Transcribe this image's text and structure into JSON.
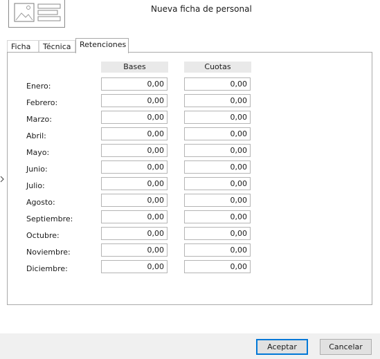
{
  "dialog": {
    "title": "Nueva ficha de personal"
  },
  "tabs": [
    {
      "label": "Ficha"
    },
    {
      "label": "Técnica"
    },
    {
      "label": "Retenciones",
      "active": true
    }
  ],
  "retenciones": {
    "columns": {
      "bases": "Bases",
      "cuotas": "Cuotas"
    },
    "rows": [
      {
        "month": "Enero:",
        "bases": "0,00",
        "cuotas": "0,00"
      },
      {
        "month": "Febrero:",
        "bases": "0,00",
        "cuotas": "0,00"
      },
      {
        "month": "Marzo:",
        "bases": "0,00",
        "cuotas": "0,00"
      },
      {
        "month": "Abril:",
        "bases": "0,00",
        "cuotas": "0,00"
      },
      {
        "month": "Mayo:",
        "bases": "0,00",
        "cuotas": "0,00"
      },
      {
        "month": "Junio:",
        "bases": "0,00",
        "cuotas": "0,00"
      },
      {
        "month": "Julio:",
        "bases": "0,00",
        "cuotas": "0,00"
      },
      {
        "month": "Agosto:",
        "bases": "0,00",
        "cuotas": "0,00"
      },
      {
        "month": "Septiembre:",
        "bases": "0,00",
        "cuotas": "0,00"
      },
      {
        "month": "Octubre:",
        "bases": "0,00",
        "cuotas": "0,00"
      },
      {
        "month": "Noviembre:",
        "bases": "0,00",
        "cuotas": "0,00"
      },
      {
        "month": "Diciembre:",
        "bases": "0,00",
        "cuotas": "0,00"
      }
    ]
  },
  "buttons": {
    "accept": "Aceptar",
    "cancel": "Cancelar"
  },
  "icons": {
    "header": "id-card-icon",
    "side": "chevron-right-icon"
  },
  "colors": {
    "accent": "#0078d7",
    "footer": "#f0f0f0",
    "column_header": "#e9e9e9"
  }
}
